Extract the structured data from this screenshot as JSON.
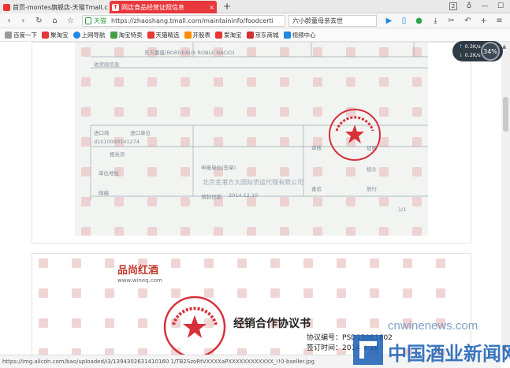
{
  "tabs": [
    {
      "title": "首页-montes旗舰店-天猫Tmall.com",
      "active": false
    },
    {
      "title": "网店食品经营证照信息",
      "active": true
    }
  ],
  "window": {
    "tab_count": "2"
  },
  "address": {
    "site_label": "天猫",
    "url": "https://zhaoshang.tmall.com/maintaininfo/foodcerti",
    "search_text": "六小龄童母亲去世"
  },
  "bookmarks": [
    "百度一下",
    "聚淘宝",
    "上网导航",
    "淘宝特卖",
    "天猫精选",
    "开股表",
    "爱淘宝",
    "京东商城",
    "视频中心"
  ],
  "doc1": {
    "line_top": "东方嘉盛(BORDEAUX ROBLE NACIO)",
    "label_info": "收货段信息",
    "col_importer": "进口商",
    "col_importer_unit": "进口单位",
    "stamp_text": "北京市品尚汇酒业有限公司",
    "serial": "d1010000141274",
    "label_bank": "报关员",
    "label_unit": "单位地址",
    "label_contact": "邮编",
    "decl_unit": "申报单位(签章)",
    "decl_company": "北京金港方大国际货运代理有限公司",
    "decl_date_label": "填制日期",
    "decl_date": "2014.12.10",
    "label_review": "审核",
    "label_tax": "征税",
    "label_stat": "统计",
    "label_check": "查验",
    "label_release": "放行",
    "page_no": "1/1"
  },
  "doc2": {
    "brand": "品尚红酒",
    "brand_url": "www.wineq.com",
    "title": "经销合作协议书",
    "agreement_no_label": "协议编号：",
    "agreement_no": "PSD15081802",
    "sign_time_label": "签订时间：",
    "sign_time": "2014-8-18"
  },
  "status": {
    "url": "https://img.alicdn.com/bao/uploaded/i3/1394302631410160 1/TB2SzoRtVXXXXaPXXXXXXXXXXXX_!!0-bseller.jpg"
  },
  "speed": {
    "up": "0.3K/s",
    "down": "0.2K/s",
    "percent": "34%"
  },
  "watermark": {
    "site": "cnwinenews.com",
    "name": "中国酒业新闻网"
  },
  "colors": {
    "active_tab": "#e8383d",
    "stamp": "#d6303a",
    "watermark_blue": "#1a5fb4"
  }
}
